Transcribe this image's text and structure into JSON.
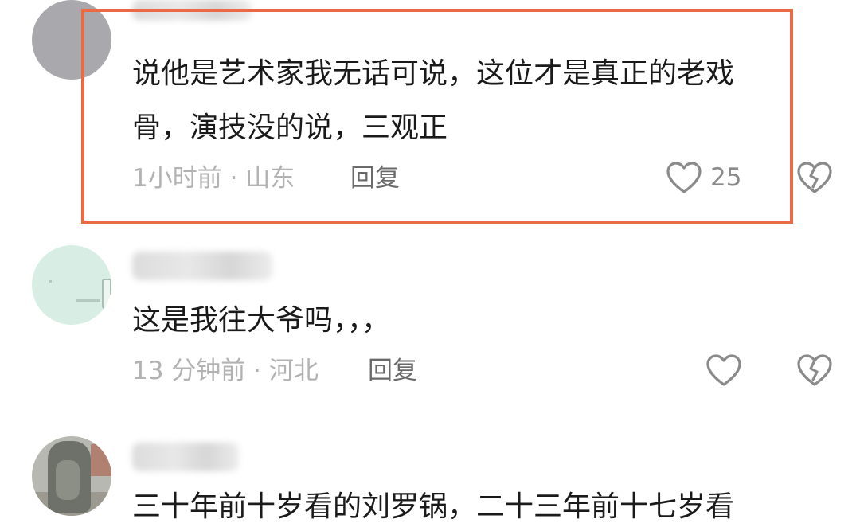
{
  "comments": [
    {
      "avatar": "gray-avatar",
      "text_line1": "说他是艺术家我无话可说，这位才是真正的老戏",
      "text_line2": "骨，演技没的说，三观正",
      "meta": "1小时前 · 山东",
      "reply_label": "回复",
      "like_count": "25",
      "like_icon": "heart-outline-icon",
      "dislike_icon": "broken-heart-icon"
    },
    {
      "avatar": "mint-avatar",
      "text_line1": "这是我往大爷吗，，，",
      "meta": "13 分钟前 · 河北",
      "reply_label": "回复",
      "like_icon": "heart-outline-icon",
      "dislike_icon": "broken-heart-icon"
    },
    {
      "avatar": "statue-avatar",
      "text_line1": "三十年前十岁看的刘罗锅，二十三年前十七岁看"
    }
  ],
  "colors": {
    "highlight_border": "#ea6a44",
    "comment_text": "#1a1a1a",
    "meta_text": "#b2b2b2",
    "reply_text": "#6a6a6a",
    "icon_stroke": "#8a8a8a"
  }
}
